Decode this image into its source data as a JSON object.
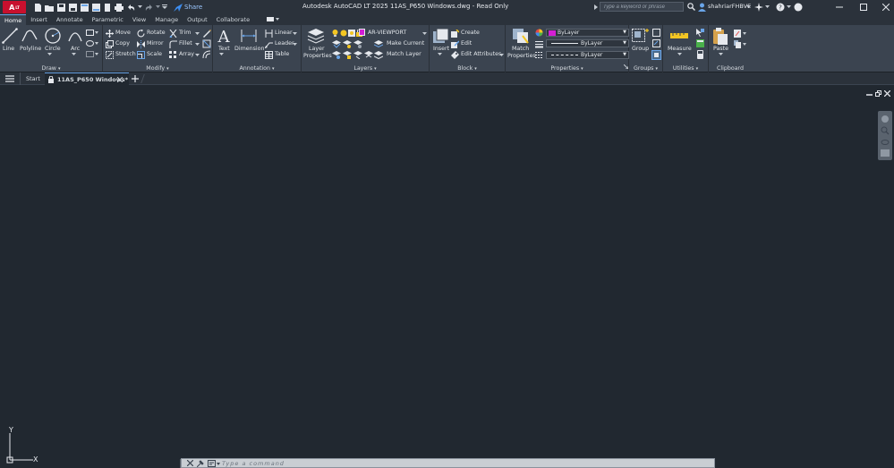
{
  "app": {
    "logo_text": "A",
    "logo_sub": "LT",
    "title": "Autodesk AutoCAD LT 2025   11AS_P650 Windows.dwg - Read Only",
    "share_label": "Share"
  },
  "search": {
    "placeholder": "Type a keyword or phrase"
  },
  "user": {
    "name": "shahriarFHBVE"
  },
  "tabs": [
    "Home",
    "Insert",
    "Annotate",
    "Parametric",
    "View",
    "Manage",
    "Output",
    "Collaborate"
  ],
  "draw": {
    "title": "Draw",
    "line": "Line",
    "polyline": "Polyline",
    "circle": "Circle",
    "arc": "Arc"
  },
  "modify": {
    "title": "Modify",
    "move": "Move",
    "rotate": "Rotate",
    "trim": "Trim",
    "copy": "Copy",
    "mirror": "Mirror",
    "fillet": "Fillet",
    "stretch": "Stretch",
    "scale": "Scale",
    "array": "Array"
  },
  "annotation": {
    "title": "Annotation",
    "text": "Text",
    "dimension": "Dimension",
    "linear": "Linear",
    "leader": "Leader",
    "table": "Table"
  },
  "layers": {
    "title": "Layers",
    "properties_1": "Layer",
    "properties_2": "Properties",
    "current_layer": "AR-VIEWPORT",
    "make_current": "Make Current",
    "match_layer": "Match Layer"
  },
  "block": {
    "title": "Block",
    "insert": "Insert",
    "create": "Create",
    "edit": "Edit",
    "edit_attributes": "Edit Attributes"
  },
  "properties": {
    "title": "Properties",
    "match_1": "Match",
    "match_2": "Properties",
    "color": "ByLayer",
    "lineweight": "ByLayer",
    "linetype": "ByLayer",
    "color_swatch": "#d41ed4"
  },
  "groups": {
    "title": "Groups",
    "group": "Group"
  },
  "utilities": {
    "title": "Utilities",
    "measure": "Measure"
  },
  "clipboard": {
    "title": "Clipboard",
    "paste": "Paste"
  },
  "doc_tabs": {
    "start": "Start",
    "active": "11AS_P650 Windows*"
  },
  "ucs": {
    "x": "X",
    "y": "Y"
  },
  "command": {
    "placeholder": "Type a command"
  }
}
